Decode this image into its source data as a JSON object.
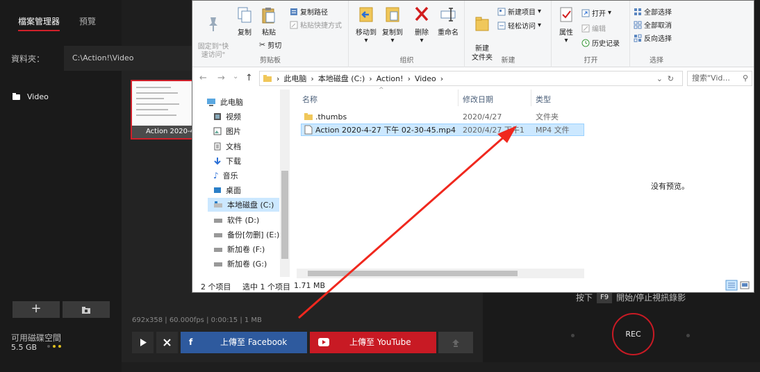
{
  "app": {
    "tabs": [
      "檔案管理器",
      "預覽"
    ],
    "folder_label": "資料夾：",
    "folder_path": "C:\\Action!\\Video",
    "tree_item": "Video",
    "add_label": "+",
    "disk_label": "可用磁碟空間",
    "disk_size": "5.5 GB",
    "thumb_caption": "Action 2020-4-",
    "media_info": "692x358 | 60.000fps | 0:00:15 | 1 MB",
    "facebook_label": "上傳至 Facebook",
    "youtube_label": "上傳至 YouTube",
    "hotkey_press": "按下",
    "hotkey_key": "F9",
    "hotkey_desc": "開始/停止視訊錄影",
    "rec_label": "REC"
  },
  "ribbon": {
    "clipboard": {
      "pin_label": "固定到\"快\n速访问\"",
      "copy_label": "复制",
      "paste_label": "粘贴",
      "copy_path": "复制路径",
      "paste_shortcut": "粘贴快捷方式",
      "cut": "剪切",
      "group": "剪贴板"
    },
    "organize": {
      "move_to": "移动到",
      "copy_to": "复制到",
      "delete": "删除",
      "rename": "重命名",
      "group": "组织"
    },
    "new": {
      "new_folder": "新建\n文件夹",
      "new_item": "新建项目",
      "easy_access": "轻松访问",
      "group": "新建"
    },
    "open": {
      "properties": "属性",
      "open": "打开",
      "edit": "编辑",
      "history": "历史记录",
      "group": "打开"
    },
    "select": {
      "select_all": "全部选择",
      "select_none": "全部取消",
      "invert": "反向选择",
      "group": "选择"
    }
  },
  "address": {
    "crumbs": [
      "此电脑",
      "本地磁盘 (C:)",
      "Action!",
      "Video"
    ],
    "search_placeholder": "搜索\"Vid...",
    "up_arrow": "↑"
  },
  "nav": {
    "items": [
      "此电脑",
      "视频",
      "图片",
      "文档",
      "下载",
      "音乐",
      "桌面",
      "本地磁盘 (C:)",
      "软件 (D:)",
      "备份[勿删] (E:)",
      "新加卷 (F:)",
      "新加卷 (G:)"
    ]
  },
  "files": {
    "columns": [
      "名称",
      "修改日期",
      "类型"
    ],
    "rows": [
      {
        "name": ".thumbs",
        "date": "2020/4/27",
        "type": "文件夹"
      },
      {
        "name": "Action 2020-4-27 下午 02-30-45.mp4",
        "date": "2020/4/27 下午1",
        "type": "MP4 文件"
      }
    ]
  },
  "preview_text": "没有预览。",
  "status": {
    "count": "2 个项目",
    "selected": "选中 1 个项目",
    "size": "1.71 MB"
  },
  "colors": {
    "accent_red": "#d0202a",
    "facebook": "#2e5a9e",
    "youtube": "#c81a24",
    "selection": "#cce8ff"
  }
}
